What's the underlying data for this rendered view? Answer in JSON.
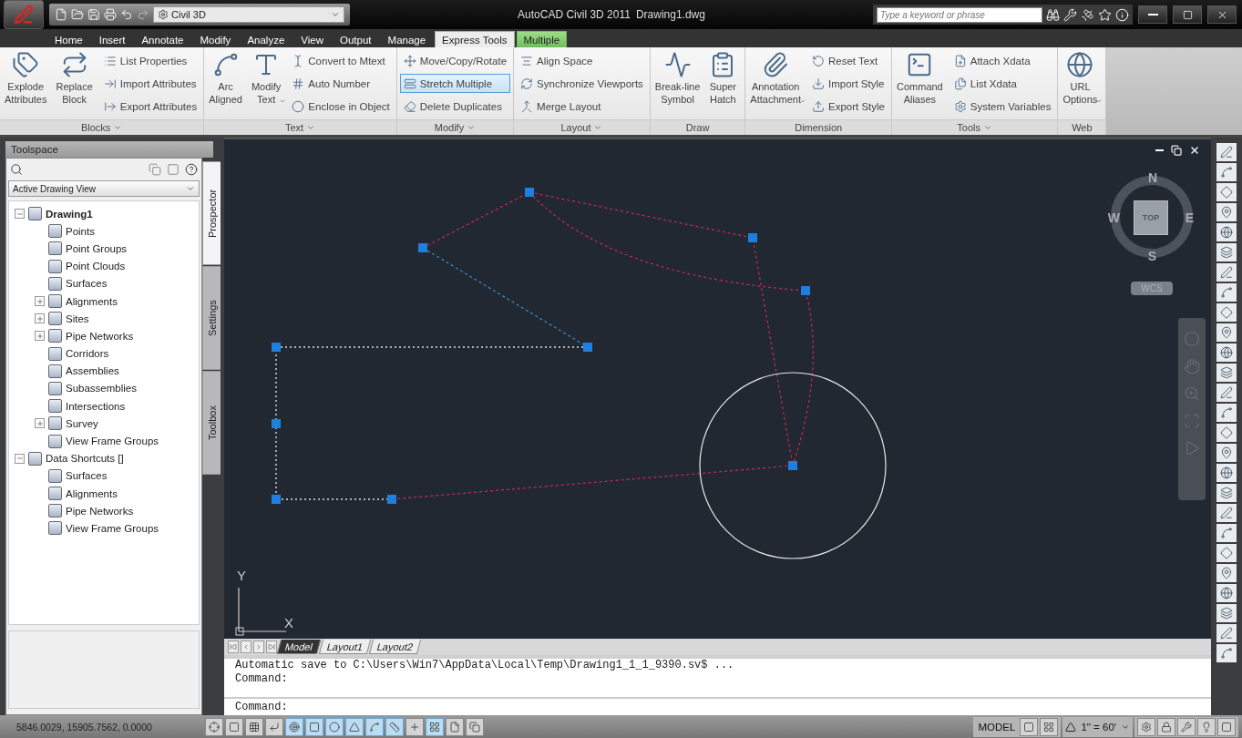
{
  "title_bar": {
    "workspace": "Civil 3D",
    "app_title": "AutoCAD Civil 3D 2011",
    "file_name": "Drawing1.dwg",
    "search": {
      "placeholder": "Type a keyword or phrase"
    }
  },
  "tabs": [
    {
      "label": "Home",
      "selected": false,
      "kind": "normal"
    },
    {
      "label": "Insert",
      "selected": false,
      "kind": "normal"
    },
    {
      "label": "Annotate",
      "selected": false,
      "kind": "normal"
    },
    {
      "label": "Modify",
      "selected": false,
      "kind": "normal"
    },
    {
      "label": "Analyze",
      "selected": false,
      "kind": "normal"
    },
    {
      "label": "View",
      "selected": false,
      "kind": "normal"
    },
    {
      "label": "Output",
      "selected": false,
      "kind": "normal"
    },
    {
      "label": "Manage",
      "selected": false,
      "kind": "normal"
    },
    {
      "label": "Express Tools",
      "selected": true,
      "kind": "normal"
    },
    {
      "label": "Multiple",
      "selected": false,
      "kind": "contextual"
    }
  ],
  "ribbon": {
    "panels": [
      {
        "title": "Blocks",
        "menu": true,
        "items": [
          {
            "kind": "large",
            "label": "Explode Attributes",
            "dropdown": false
          },
          {
            "kind": "large",
            "label": "Replace Block",
            "dropdown": false
          },
          {
            "kind": "stack",
            "items": [
              {
                "label": "List Properties",
                "selected": false
              },
              {
                "label": "Import Attributes",
                "selected": false
              },
              {
                "label": "Export Attributes",
                "selected": false
              }
            ]
          }
        ]
      },
      {
        "title": "Text",
        "menu": true,
        "items": [
          {
            "kind": "large",
            "label": "Arc Aligned",
            "dropdown": false
          },
          {
            "kind": "large",
            "label": "Modify Text",
            "dropdown": true
          },
          {
            "kind": "stack",
            "items": [
              {
                "label": "Convert to Mtext",
                "selected": false
              },
              {
                "label": "Auto Number",
                "selected": false
              },
              {
                "label": "Enclose in Object",
                "selected": false
              }
            ]
          }
        ]
      },
      {
        "title": "Modify",
        "menu": true,
        "items": [
          {
            "kind": "stack",
            "items": [
              {
                "label": "Move/Copy/Rotate",
                "selected": false
              },
              {
                "label": "Stretch Multiple",
                "selected": true
              },
              {
                "label": "Delete Duplicates",
                "selected": false
              }
            ]
          }
        ]
      },
      {
        "title": "Layout",
        "menu": true,
        "items": [
          {
            "kind": "stack",
            "items": [
              {
                "label": "Align Space",
                "selected": false
              },
              {
                "label": "Synchronize Viewports",
                "selected": false
              },
              {
                "label": "Merge Layout",
                "selected": false
              }
            ]
          }
        ]
      },
      {
        "title": "Draw",
        "menu": false,
        "items": [
          {
            "kind": "large",
            "label": "Break-line Symbol",
            "dropdown": false
          },
          {
            "kind": "large",
            "label": "Super Hatch",
            "dropdown": false
          }
        ]
      },
      {
        "title": "Dimension",
        "menu": false,
        "items": [
          {
            "kind": "large",
            "label": "Annotation Attachment",
            "dropdown": true
          },
          {
            "kind": "stack",
            "items": [
              {
                "label": "Reset Text",
                "selected": false
              },
              {
                "label": "Import Style",
                "selected": false
              },
              {
                "label": "Export Style",
                "selected": false
              }
            ]
          }
        ]
      },
      {
        "title": "Tools",
        "menu": true,
        "items": [
          {
            "kind": "large",
            "label": "Command Aliases",
            "dropdown": false
          },
          {
            "kind": "stack",
            "items": [
              {
                "label": "Attach Xdata",
                "selected": false
              },
              {
                "label": "List Xdata",
                "selected": false
              },
              {
                "label": "System Variables",
                "selected": false
              }
            ]
          }
        ]
      },
      {
        "title": "Web",
        "menu": false,
        "items": [
          {
            "kind": "large",
            "label": "URL Options",
            "dropdown": true
          }
        ]
      }
    ]
  },
  "toolspace": {
    "title": "Toolspace",
    "view": "Active Drawing View",
    "tree": [
      {
        "label": "Drawing1",
        "bold": true,
        "kind": "branch",
        "expanded": true,
        "children": [
          {
            "label": "Points",
            "kind": "leaf"
          },
          {
            "label": "Point Groups",
            "kind": "leaf"
          },
          {
            "label": "Point Clouds",
            "kind": "leaf"
          },
          {
            "label": "Surfaces",
            "kind": "leaf"
          },
          {
            "label": "Alignments",
            "kind": "branch",
            "expanded": false
          },
          {
            "label": "Sites",
            "kind": "branch",
            "expanded": false
          },
          {
            "label": "Pipe Networks",
            "kind": "branch",
            "expanded": false
          },
          {
            "label": "Corridors",
            "kind": "leaf"
          },
          {
            "label": "Assemblies",
            "kind": "leaf"
          },
          {
            "label": "Subassemblies",
            "kind": "leaf"
          },
          {
            "label": "Intersections",
            "kind": "leaf"
          },
          {
            "label": "Survey",
            "kind": "branch",
            "expanded": false
          },
          {
            "label": "View Frame Groups",
            "kind": "leaf"
          }
        ]
      },
      {
        "label": "Data Shortcuts []",
        "bold": false,
        "kind": "branch",
        "expanded": true,
        "children": [
          {
            "label": "Surfaces",
            "kind": "leaf"
          },
          {
            "label": "Alignments",
            "kind": "leaf"
          },
          {
            "label": "Pipe Networks",
            "kind": "leaf"
          },
          {
            "label": "View Frame Groups",
            "kind": "leaf"
          }
        ]
      }
    ],
    "side_tabs": [
      {
        "label": "Prospector",
        "selected": true
      },
      {
        "label": "Settings",
        "selected": false
      },
      {
        "label": "Toolbox",
        "selected": false
      }
    ]
  },
  "viewport": {
    "viewcube": {
      "north": "N",
      "east": "E",
      "south": "S",
      "west": "W",
      "face": "TOP",
      "ucs": "WCS"
    },
    "ucs_icon": {
      "x": "X",
      "y": "Y"
    }
  },
  "layout_tabs": [
    {
      "label": "Model",
      "selected": true
    },
    {
      "label": "Layout1",
      "selected": false
    },
    {
      "label": "Layout2",
      "selected": false
    }
  ],
  "command_window": {
    "history": [
      "Automatic save to C:\\Users\\Win7\\AppData\\Local\\Temp\\Drawing1_1_1_9390.sv$ ...",
      "Command:"
    ],
    "prompt": "Command:"
  },
  "status_bar": {
    "coordinates": "5846.0029, 15905.7562, 0.0000",
    "toggles": [
      {
        "on": false
      },
      {
        "on": false
      },
      {
        "on": false
      },
      {
        "on": false
      },
      {
        "on": true
      },
      {
        "on": true
      },
      {
        "on": true
      },
      {
        "on": true
      },
      {
        "on": true
      },
      {
        "on": true
      },
      {
        "on": false
      },
      {
        "on": true
      },
      {
        "on": false
      },
      {
        "on": false
      }
    ],
    "space": "MODEL",
    "scale": "1\" = 60'"
  }
}
